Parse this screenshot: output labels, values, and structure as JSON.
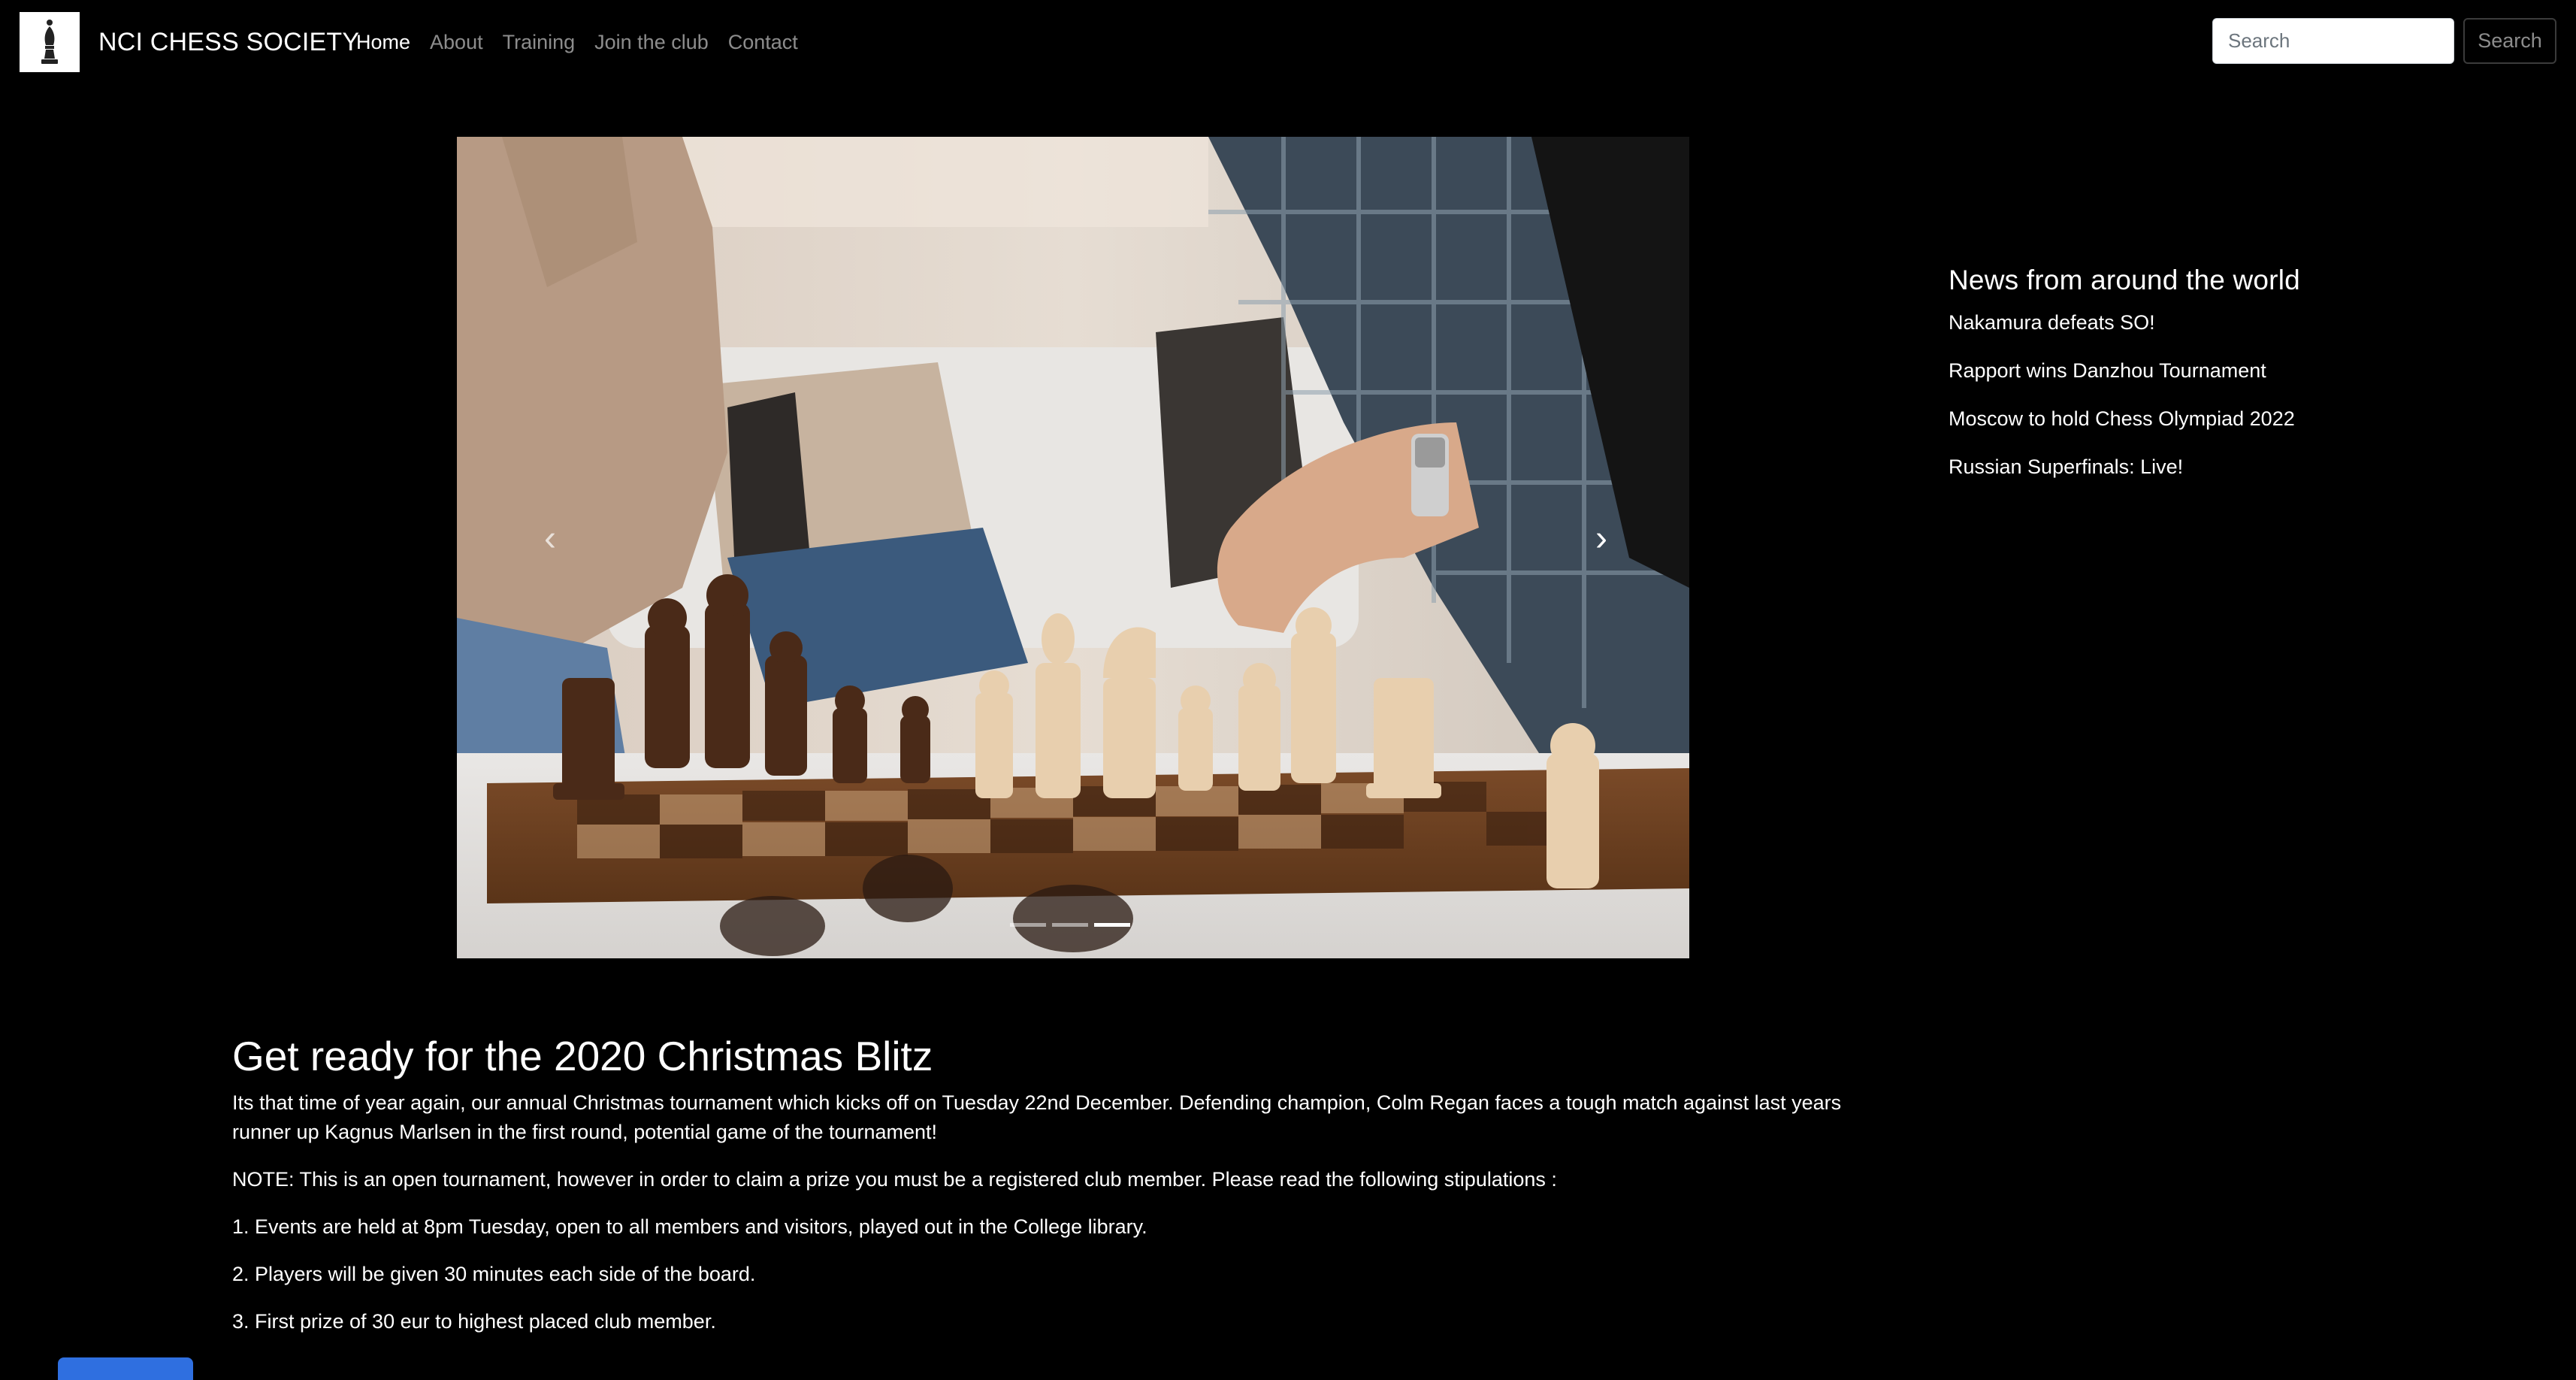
{
  "navbar": {
    "brand": "NCI CHESS SOCIETY",
    "logo_icon": "chess-bishop-icon",
    "links": [
      {
        "label": "Home",
        "active": true
      },
      {
        "label": "About",
        "active": false
      },
      {
        "label": "Training",
        "active": false
      },
      {
        "label": "Join the club",
        "active": false
      },
      {
        "label": "Contact",
        "active": false
      }
    ],
    "search": {
      "placeholder": "Search",
      "value": "",
      "button_label": "Search"
    }
  },
  "carousel": {
    "prev_icon": "chevron-left-icon",
    "next_icon": "chevron-right-icon",
    "prev_glyph": "‹",
    "next_glyph": "›",
    "slides_count": 3,
    "active_slide": 3
  },
  "news": {
    "title": "News from around the world",
    "items": [
      "Nakamura defeats SO!",
      "Rapport wins Danzhou Tournament",
      "Moscow to hold Chess Olympiad 2022",
      "Russian Superfinals: Live!"
    ]
  },
  "article": {
    "title": "Get ready for the 2020 Christmas Blitz",
    "paragraphs": [
      "Its that time of year again, our annual Christmas tournament which kicks off on Tuesday 22nd December. Defending champion, Colm Regan faces a tough match against last years runner up Kagnus Marlsen in the first round, potential game of the tournament!",
      "NOTE: This is an open tournament, however in order to claim a prize you must be a registered club member. Please read the following stipulations :",
      "1. Events are held at 8pm Tuesday, open to all members and visitors, played out in the College library.",
      "2. Players will be given 30 minutes each side of the board.",
      "3. First prize of 30 eur to highest placed club member."
    ]
  },
  "colors": {
    "background": "#000000",
    "accent": "#2f6fe0",
    "nav_inactive": "rgba(255,255,255,0.55)"
  }
}
